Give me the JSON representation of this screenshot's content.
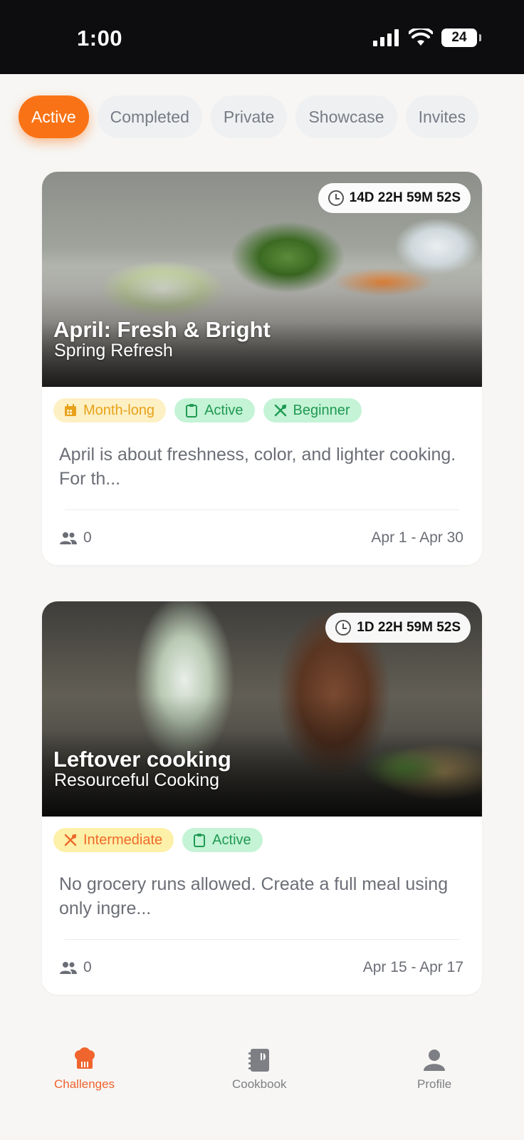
{
  "status_bar": {
    "time": "1:00",
    "battery": "24"
  },
  "tabs": [
    {
      "label": "Active",
      "selected": true
    },
    {
      "label": "Completed",
      "selected": false
    },
    {
      "label": "Private",
      "selected": false
    },
    {
      "label": "Showcase",
      "selected": false
    },
    {
      "label": "Invites",
      "selected": false
    }
  ],
  "challenges": [
    {
      "timer": "14D 22H 59M 52S",
      "title": "April: Fresh & Bright",
      "subtitle": "Spring Refresh",
      "badges": [
        "Month-long",
        "Active",
        "Beginner"
      ],
      "description": "April is about freshness, color, and lighter cooking. For th...",
      "participants": "0",
      "date_range": "Apr 1 -  Apr 30"
    },
    {
      "timer": "1D 22H 59M 52S",
      "title": "Leftover cooking",
      "subtitle": "Resourceful Cooking",
      "badges": [
        "Intermediate",
        "Active"
      ],
      "description": "No grocery runs allowed. Create a full meal using only ingre...",
      "participants": "0",
      "date_range": "Apr 15 -  Apr 17"
    }
  ],
  "bottom_nav": [
    {
      "label": "Challenges",
      "icon": "chef-hat-icon",
      "active": true
    },
    {
      "label": "Cookbook",
      "icon": "cookbook-icon",
      "active": false
    },
    {
      "label": "Profile",
      "icon": "profile-icon",
      "active": false
    }
  ],
  "colors": {
    "accent": "#f97316",
    "active_green": "#1f9a52",
    "nav_active": "#f0642e"
  }
}
